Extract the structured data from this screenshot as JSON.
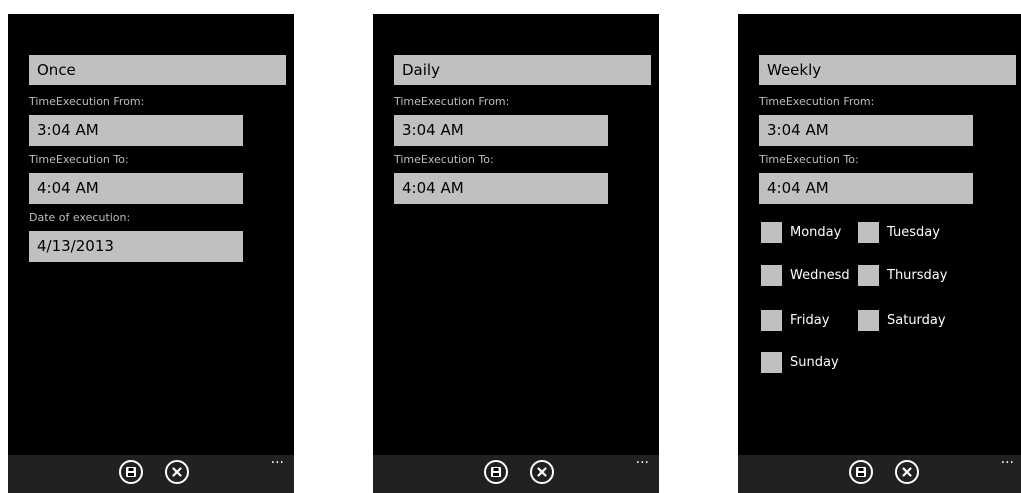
{
  "screens": [
    {
      "mode": "Once",
      "time_from_label": "TimeExecution From:",
      "time_from": "3:04 AM",
      "time_to_label": "TimeExecution To:",
      "time_to": "4:04 AM",
      "date_label": "Date of execution:",
      "date": "4/13/2013"
    },
    {
      "mode": "Daily",
      "time_from_label": "TimeExecution From:",
      "time_from": "3:04 AM",
      "time_to_label": "TimeExecution To:",
      "time_to": "4:04 AM"
    },
    {
      "mode": "Weekly",
      "time_from_label": "TimeExecution From:",
      "time_from": "3:04 AM",
      "time_to_label": "TimeExecution To:",
      "time_to": "4:04 AM",
      "days": [
        "Monday",
        "Tuesday",
        "Wednesd",
        "Thursday",
        "Friday",
        "Saturday",
        "Sunday"
      ]
    }
  ],
  "app_bar": {
    "save_icon": "save-icon",
    "cancel_icon": "close-icon",
    "more": "..."
  },
  "colors": {
    "background": "#000000",
    "field": "#c0c0c0",
    "label": "#bdbdbd",
    "app_bar": "#212121"
  }
}
